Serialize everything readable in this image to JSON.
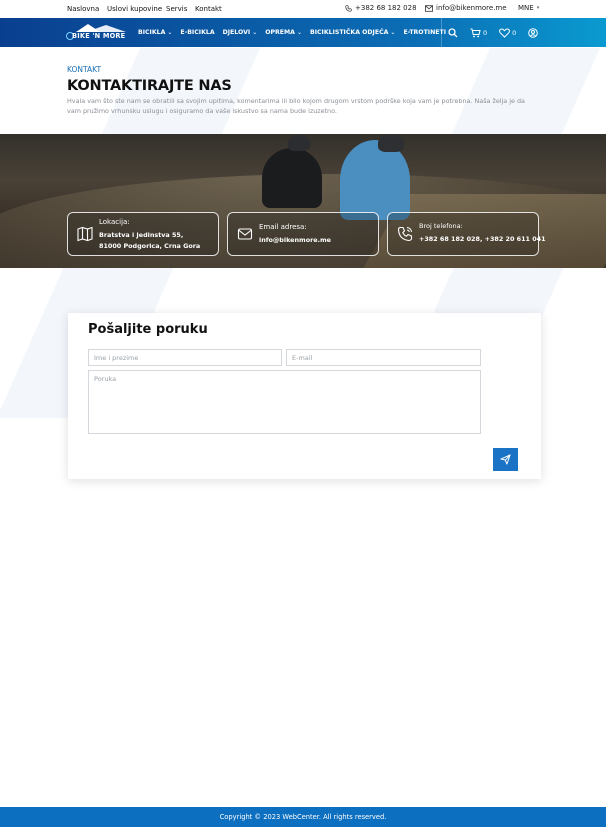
{
  "topbar": {
    "links": [
      "Naslovna",
      "Uslovi kupovine",
      "Servis",
      "Kontakt"
    ],
    "phone": "+382 68 182 028",
    "email": "info@bikenmore.me",
    "language": "MNE"
  },
  "nav": {
    "logo_text": "BIKE 'N MORE",
    "menu": [
      {
        "label": "BICIKLA",
        "has_dropdown": true
      },
      {
        "label": "E-BICIKLA",
        "has_dropdown": false
      },
      {
        "label": "DJELOVI",
        "has_dropdown": true
      },
      {
        "label": "OPREMA",
        "has_dropdown": true
      },
      {
        "label": "BICIKLISTIČKA ODJEĆA",
        "has_dropdown": true
      },
      {
        "label": "E-TROTINETI",
        "has_dropdown": false
      }
    ],
    "cart_count": "0",
    "wishlist_count": "0",
    "icons": [
      "search-icon",
      "cart-icon",
      "heart-icon",
      "user-icon"
    ]
  },
  "header": {
    "breadcrumb": "KONTAKT",
    "title": "KONTAKTIRAJTE NAS",
    "lead": "Hvala vam što ste nam se obratili sa svojim upitima, komentarima ili bilo kojom drugom vrstom podrške koja vam je potrebna. Naša želja je da vam pružimo vrhunsku uslugu i osiguramo da vaše iskustvo sa nama bude izuzetno."
  },
  "info": {
    "location": {
      "label": "Lokacija:",
      "line1": "Bratstva i Jedinstva 55,",
      "line2": "81000 Podgorica, Crna Gora",
      "icon": "map-icon"
    },
    "email": {
      "label": "Email adresa:",
      "value": "info@bikenmore.me",
      "icon": "mail-icon"
    },
    "phone": {
      "label": "Broj telefona:",
      "value": "+382 68 182 028, +382 20 611 041",
      "icon": "phone-icon"
    }
  },
  "form": {
    "title": "Pošaljite poruku",
    "name_placeholder": "Ime i prezime",
    "email_placeholder": "E-mail",
    "message_placeholder": "Poruka"
  },
  "footer": {
    "copyright": "Copyright © 2023 WebCenter. All rights reserved."
  },
  "colors": {
    "accent": "#1a73c4",
    "nav_start": "#0a3f8f",
    "nav_end": "#0a9ad0",
    "footer": "#0d6fbf"
  }
}
